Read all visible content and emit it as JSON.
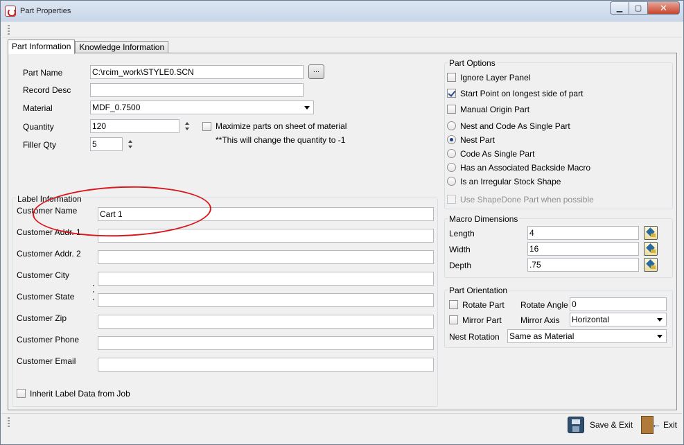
{
  "window": {
    "title": "Part Properties",
    "minimize": "▁",
    "maximize": "▢",
    "close": "✕"
  },
  "tabs": [
    {
      "label": "Part Information"
    },
    {
      "label": "Knowledge Information"
    }
  ],
  "part_info": {
    "part_name_label": "Part Name",
    "part_name_value": "C:\\rcim_work\\STYLE0.SCN",
    "browse_label": "...",
    "record_desc_label": "Record Desc",
    "record_desc_value": "",
    "material_label": "Material",
    "material_value": "MDF_0.7500",
    "quantity_label": "Quantity",
    "quantity_value": "120",
    "maximize_label": "Maximize parts on sheet of material",
    "maximize_note": "**This will change the quantity to -1",
    "filler_label": "Filler Qty",
    "filler_value": "5"
  },
  "label_info": {
    "title": "Label Information",
    "customer_name_label": "Customer Name",
    "customer_name_value": "Cart 1",
    "addr1_label": "Customer Addr. 1",
    "addr1_value": "",
    "addr2_label": "Customer Addr. 2",
    "addr2_value": "",
    "city_label": "Customer City",
    "city_value": "",
    "state_label": "Customer State",
    "state_value": "",
    "zip_label": "Customer Zip",
    "zip_value": "",
    "phone_label": "Customer Phone",
    "phone_value": "",
    "email_label": "Customer Email",
    "email_value": "",
    "inherit_label": "Inherit Label Data from Job"
  },
  "part_options": {
    "title": "Part Options",
    "ignore_layer": "Ignore Layer Panel",
    "start_point": "Start Point on longest side of part",
    "manual_origin": "Manual Origin Part",
    "nest_code_single": "Nest and Code As Single Part",
    "nest_part": "Nest Part",
    "code_single": "Code As Single Part",
    "backside_macro": "Has an Associated Backside Macro",
    "irregular_stock": "Is an Irregular Stock Shape",
    "shapedone": "Use ShapeDone Part when possible"
  },
  "macro_dimensions": {
    "title": "Macro Dimensions",
    "length_label": "Length",
    "length_value": "4",
    "width_label": "Width",
    "width_value": "16",
    "depth_label": "Depth",
    "depth_value": ".75"
  },
  "part_orientation": {
    "title": "Part Orientation",
    "rotate_part": "Rotate Part",
    "rotate_angle_label": "Rotate Angle",
    "rotate_angle_value": "0",
    "mirror_part": "Mirror Part",
    "mirror_axis_label": "Mirror Axis",
    "mirror_axis_value": "Horizontal",
    "nest_rotation_label": "Nest Rotation",
    "nest_rotation_value": "Same as Material"
  },
  "footer": {
    "save_exit": "Save & Exit",
    "exit": "Exit"
  }
}
